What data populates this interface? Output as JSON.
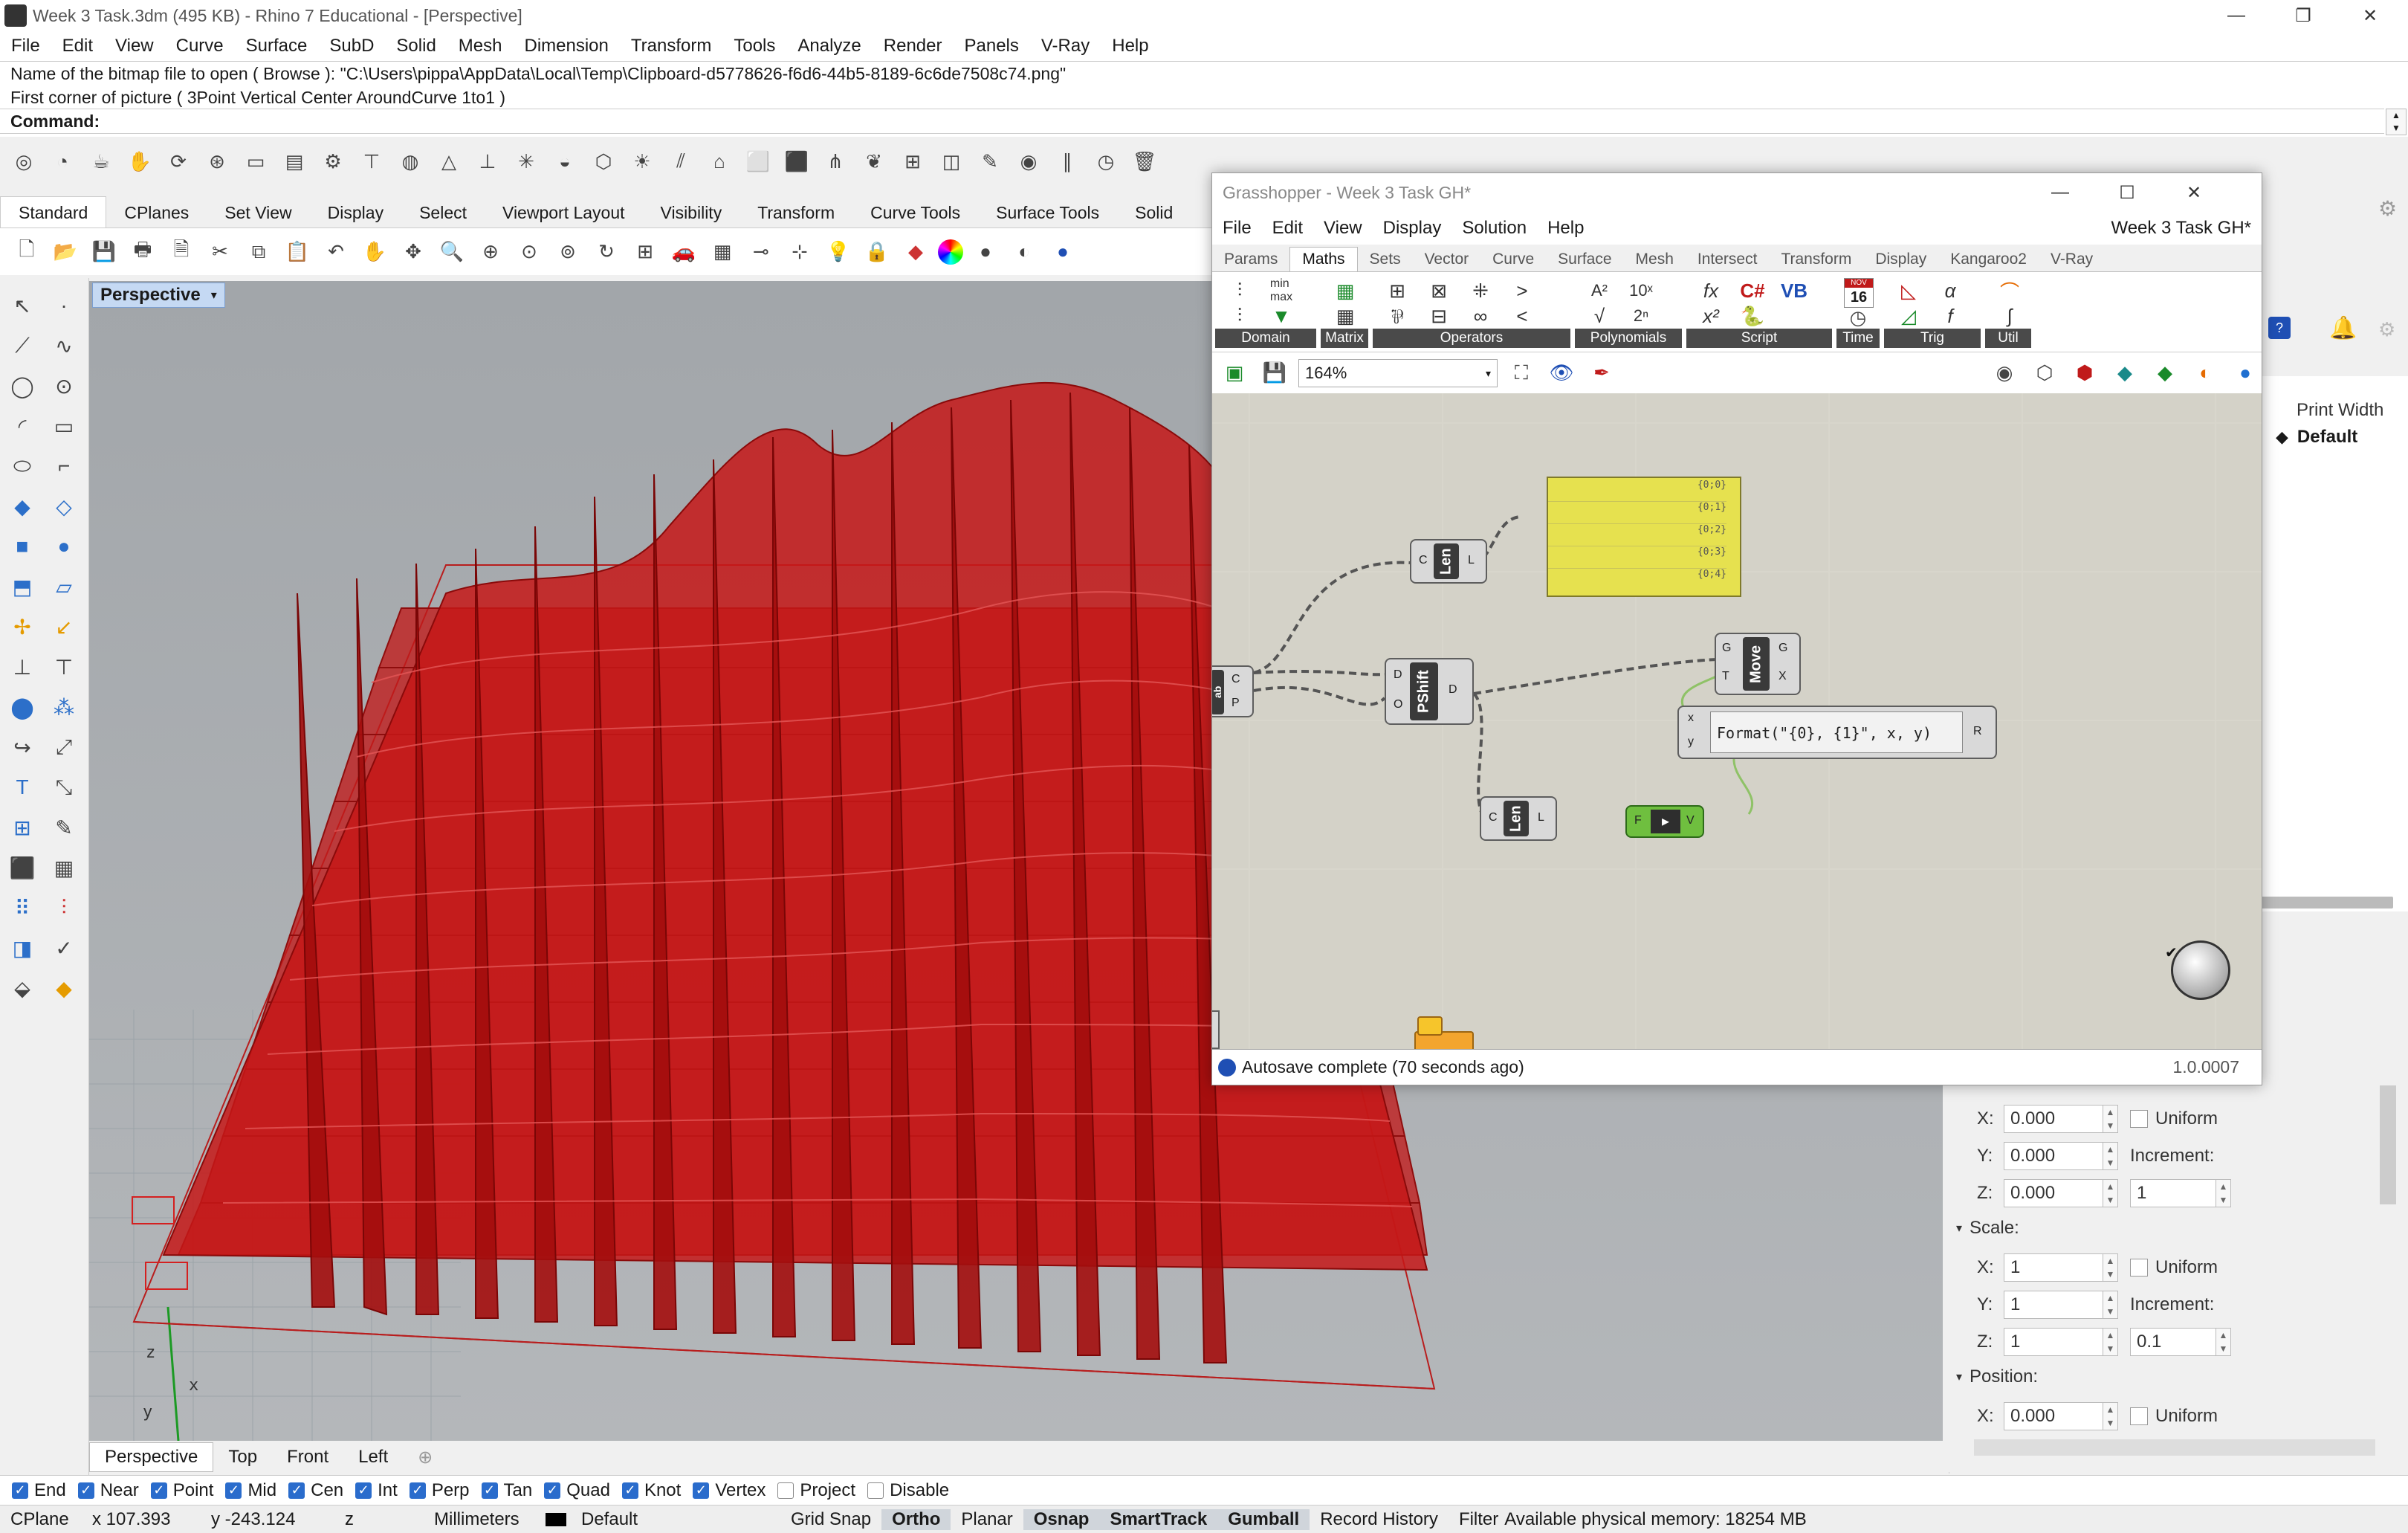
{
  "app": {
    "title": "Week 3 Task.3dm (495 KB) - Rhino 7 Educational - [Perspective]",
    "menu": [
      "File",
      "Edit",
      "View",
      "Curve",
      "Surface",
      "SubD",
      "Solid",
      "Mesh",
      "Dimension",
      "Transform",
      "Tools",
      "Analyze",
      "Render",
      "Panels",
      "V-Ray",
      "Help"
    ]
  },
  "command_history": [
    "Name of the bitmap file to open ( Browse ): \"C:\\Users\\pippa\\AppData\\Local\\Temp\\Clipboard-d5778626-f6d6-44b5-8189-6c6de7508c74.png\"",
    "First corner of picture ( 3Point  Vertical  Center  AroundCurve  1to1 )"
  ],
  "command_prompt": "Command:",
  "toolbar_tabs": [
    "Standard",
    "CPlanes",
    "Set View",
    "Display",
    "Select",
    "Viewport Layout",
    "Visibility",
    "Transform",
    "Curve Tools",
    "Surface Tools",
    "Solid"
  ],
  "active_toolbar_tab": "Standard",
  "viewport": {
    "name": "Perspective",
    "tabs": [
      "Perspective",
      "Top",
      "Front",
      "Left"
    ],
    "active_tab": "Perspective",
    "axis_labels": {
      "x": "x",
      "y": "y",
      "z": "z"
    }
  },
  "osnaps": [
    {
      "label": "End",
      "checked": true
    },
    {
      "label": "Near",
      "checked": true
    },
    {
      "label": "Point",
      "checked": true
    },
    {
      "label": "Mid",
      "checked": true
    },
    {
      "label": "Cen",
      "checked": true
    },
    {
      "label": "Int",
      "checked": true
    },
    {
      "label": "Perp",
      "checked": true
    },
    {
      "label": "Tan",
      "checked": true
    },
    {
      "label": "Quad",
      "checked": true
    },
    {
      "label": "Knot",
      "checked": true
    },
    {
      "label": "Vertex",
      "checked": true
    },
    {
      "label": "Project",
      "checked": false
    },
    {
      "label": "Disable",
      "checked": false
    }
  ],
  "status": {
    "cplane": "CPlane",
    "x": "x 107.393",
    "y": "y -243.124",
    "z": "z",
    "units": "Millimeters",
    "layer": "Default",
    "grid_snap": "Grid Snap",
    "ortho": "Ortho",
    "planar": "Planar",
    "osnap": "Osnap",
    "smarttrack": "SmartTrack",
    "gumball": "Gumball",
    "record_history": "Record History",
    "filter": "Filter",
    "memory": "Available physical memory: 18254 MB"
  },
  "right_panel": {
    "print_width_label": "Print Width",
    "default_label": "Default",
    "rotation": {
      "x": "0.000",
      "y": "0.000",
      "z": "0.000",
      "uniform": "Uniform",
      "increment_label": "Increment:",
      "increment": "1"
    },
    "scale": {
      "title": "Scale:",
      "x": "1",
      "y": "1",
      "z": "1",
      "uniform": "Uniform",
      "increment_label": "Increment:",
      "increment": "0.1"
    },
    "position": {
      "title": "Position:",
      "x": "0.000",
      "uniform": "Uniform"
    },
    "axis_labels": {
      "x": "X:",
      "y": "Y:",
      "z": "Z:"
    }
  },
  "grasshopper": {
    "title": "Grasshopper - Week 3 Task GH*",
    "doc_name": "Week 3 Task GH*",
    "menu": [
      "File",
      "Edit",
      "View",
      "Display",
      "Solution",
      "Help"
    ],
    "tabs": [
      "Params",
      "Maths",
      "Sets",
      "Vector",
      "Curve",
      "Surface",
      "Mesh",
      "Intersect",
      "Transform",
      "Display",
      "Kangaroo2",
      "V-Ray"
    ],
    "active_tab": "Maths",
    "ribbon_groups": [
      "Domain",
      "Matrix",
      "Operators",
      "Polynomials",
      "Script",
      "Time",
      "Trig",
      "Util"
    ],
    "time_icon_top": "NOV",
    "time_icon_day": "16",
    "zoom": "164%",
    "panel_items": [
      "{0;0}",
      "{0;1}",
      "{0;2}",
      "{0;3}",
      "{0;4}"
    ],
    "nodes": {
      "len1": {
        "name": "Len",
        "in": "C",
        "out": "L"
      },
      "len2": {
        "name": "Len",
        "in": "C",
        "out": "L"
      },
      "pshift": {
        "name": "PShift",
        "in1": "D",
        "in2": "O",
        "out": "D"
      },
      "move": {
        "name": "Move",
        "in1": "G",
        "in2": "T",
        "out1": "G",
        "out2": "X"
      },
      "format": {
        "text": "Format(\"{0}, {1}\", x, y)",
        "in1": "x",
        "in2": "y",
        "out": "R"
      },
      "toggle": {
        "in": "F",
        "out": "V"
      },
      "left_partial": {
        "name": "ab",
        "in1": "C",
        "in2": "P"
      }
    },
    "status": "Autosave complete (70 seconds ago)",
    "version": "1.0.0007"
  }
}
